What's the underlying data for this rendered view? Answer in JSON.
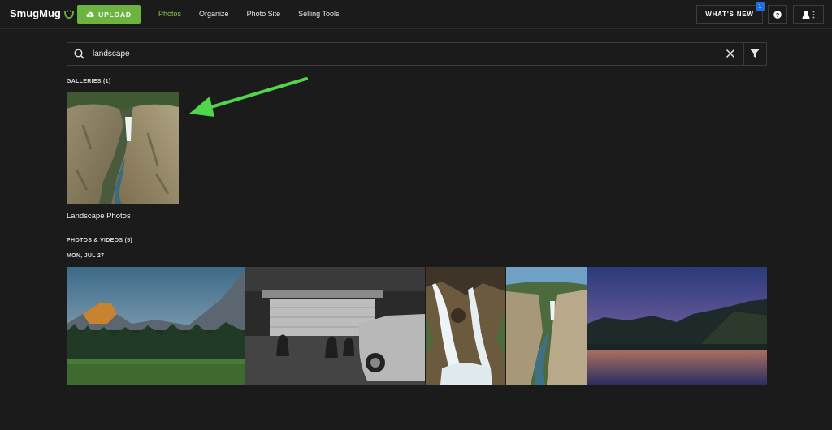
{
  "header": {
    "logo_text": "SmugMug",
    "upload_label": "UPLOAD",
    "nav": [
      {
        "label": "Photos",
        "active": true
      },
      {
        "label": "Organize",
        "active": false
      },
      {
        "label": "Photo Site",
        "active": false
      },
      {
        "label": "Selling Tools",
        "active": false
      }
    ],
    "whats_new_label": "WHAT'S NEW",
    "whats_new_badge": "1",
    "help_icon": "question-icon",
    "user_icon": "user-icon",
    "accent_color": "#6db33f"
  },
  "search": {
    "query": "landscape",
    "search_icon": "search-icon",
    "clear_icon": "close-icon",
    "filter_icon": "filter-icon"
  },
  "galleries": {
    "heading": "GALLERIES (1)",
    "items": [
      {
        "title": "Landscape Photos"
      }
    ]
  },
  "photos": {
    "heading": "PHOTOS & VIDEOS (5)",
    "date_heading": "MON, JUL 27"
  }
}
